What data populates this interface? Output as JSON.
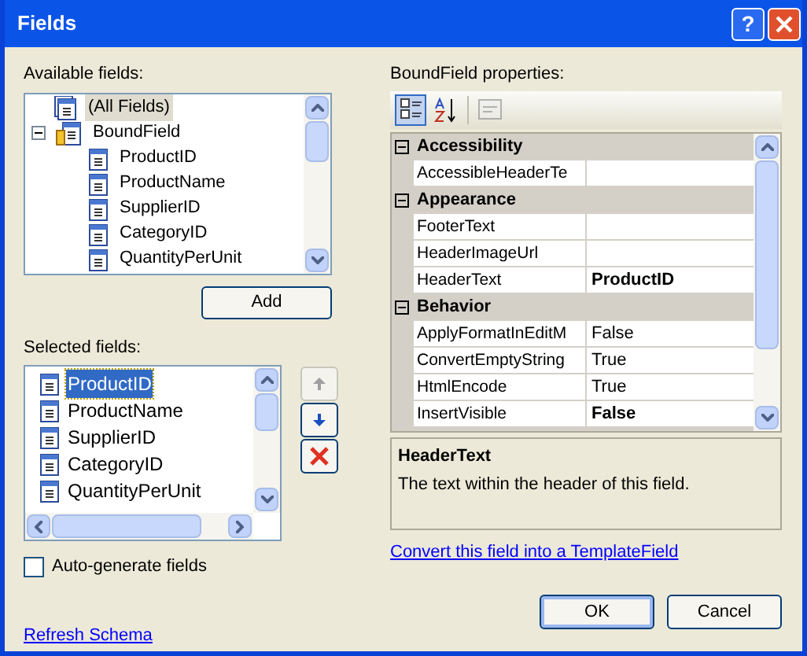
{
  "window": {
    "title": "Fields",
    "help_button": "?"
  },
  "available_fields": {
    "label": "Available fields:",
    "items": [
      {
        "label": "(All Fields)",
        "kind": "all",
        "selected": true
      },
      {
        "label": "BoundField",
        "kind": "group",
        "expanded": true,
        "selected": false,
        "children": [
          {
            "label": "ProductID",
            "kind": "field",
            "selected": false
          },
          {
            "label": "ProductName",
            "kind": "field",
            "selected": false
          },
          {
            "label": "SupplierID",
            "kind": "field",
            "selected": false
          },
          {
            "label": "CategoryID",
            "kind": "field",
            "selected": false
          },
          {
            "label": "QuantityPerUnit",
            "kind": "field",
            "selected": false
          }
        ]
      }
    ],
    "add_button": "Add"
  },
  "selected_fields": {
    "label": "Selected fields:",
    "items": [
      {
        "label": "ProductID",
        "selected": true
      },
      {
        "label": "ProductName",
        "selected": false
      },
      {
        "label": "SupplierID",
        "selected": false
      },
      {
        "label": "CategoryID",
        "selected": false
      },
      {
        "label": "QuantityPerUnit",
        "selected": false
      }
    ],
    "move_up_disabled": true,
    "move_down_disabled": false,
    "delete_disabled": false
  },
  "auto_generate": {
    "label": "Auto-generate fields",
    "checked": false
  },
  "refresh_link": "Refresh Schema",
  "properties": {
    "label": "BoundField properties:",
    "categorized_selected": true,
    "alphabetical_selected": false,
    "rows": [
      {
        "kind": "category",
        "name": "Accessibility",
        "expanded": true
      },
      {
        "kind": "property",
        "name": "AccessibleHeaderTe"
      },
      {
        "kind": "category",
        "name": "Appearance",
        "expanded": true
      },
      {
        "kind": "property",
        "name": "FooterText"
      },
      {
        "kind": "property",
        "name": "HeaderImageUrl"
      },
      {
        "kind": "property",
        "name": "HeaderText",
        "value": "ProductID",
        "modified": true
      },
      {
        "kind": "category",
        "name": "Behavior",
        "expanded": true
      },
      {
        "kind": "property",
        "name": "ApplyFormatInEditM",
        "value": "False",
        "modified": false
      },
      {
        "kind": "property",
        "name": "ConvertEmptyString",
        "value": "True",
        "modified": false
      },
      {
        "kind": "property",
        "name": "HtmlEncode",
        "value": "True",
        "modified": false
      },
      {
        "kind": "property",
        "name": "InsertVisible",
        "value": "False",
        "modified": true
      }
    ],
    "description_title": "HeaderText",
    "description": "The text within the header of this field."
  },
  "convert_link": "Convert this field into a TemplateField",
  "buttons": [
    {
      "label": "OK",
      "default": true
    },
    {
      "label": "Cancel",
      "default": false
    }
  ]
}
